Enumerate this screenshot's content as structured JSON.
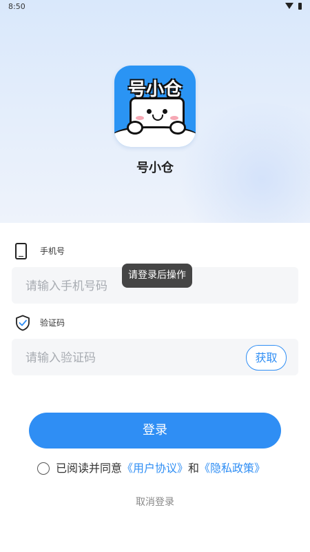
{
  "status_bar": {
    "time": "8:50"
  },
  "app": {
    "icon_text": "号小仓",
    "name": "号小仓"
  },
  "phone": {
    "label": "手机号",
    "placeholder": "请输入手机号码",
    "value": ""
  },
  "code": {
    "label": "验证码",
    "placeholder": "请输入验证码",
    "value": "",
    "get_code_label": "获取"
  },
  "toast": {
    "text": "请登录后操作"
  },
  "login_button": {
    "label": "登录"
  },
  "agreement": {
    "prefix": "已阅读并同意",
    "user_agreement": "《用户协议》",
    "and": "和",
    "privacy_policy": "《隐私政策》",
    "checked": false
  },
  "cancel_label": "取消登录",
  "colors": {
    "accent": "#2f8ef4",
    "toast_bg": "#454545",
    "input_bg": "#f5f6f8"
  }
}
